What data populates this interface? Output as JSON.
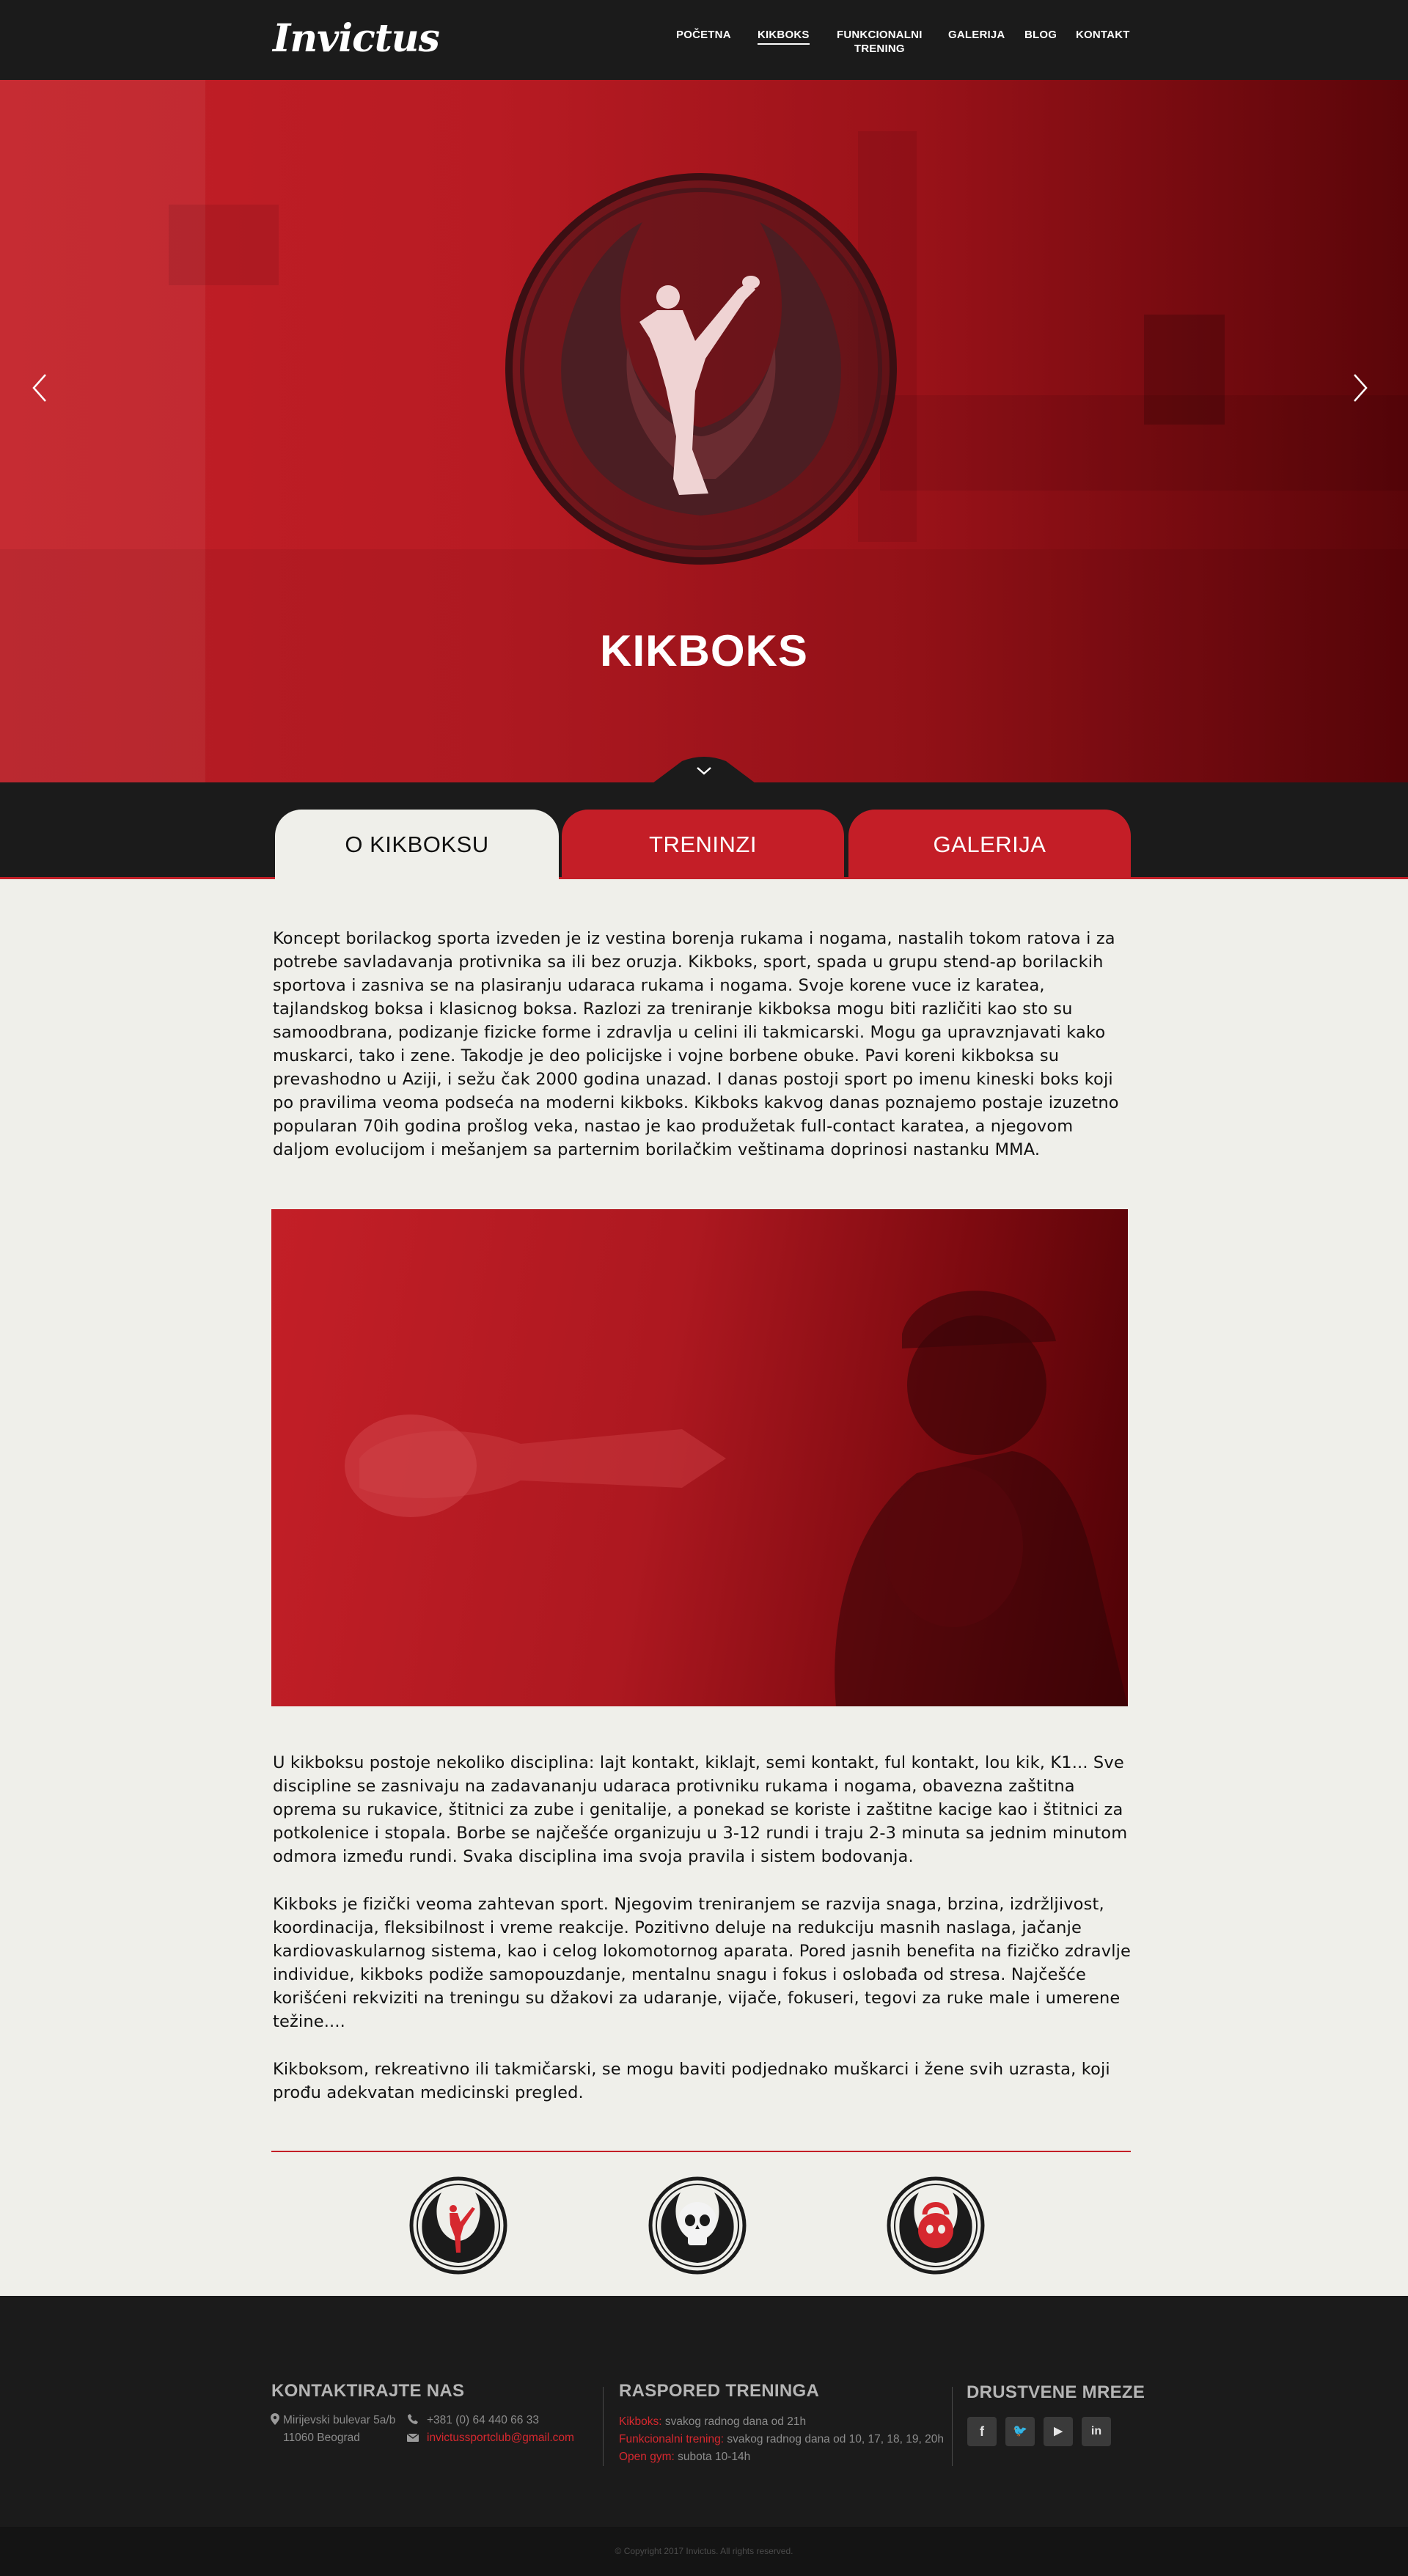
{
  "header": {
    "logo": "Invictus",
    "nav": [
      {
        "label": "POČETNA"
      },
      {
        "label": "KIKBOKS",
        "active": true
      },
      {
        "label": "FUNKCIONALNI\nTRENING"
      },
      {
        "label": "GALERIJA"
      },
      {
        "label": "BLOG"
      },
      {
        "label": "KONTAKT"
      }
    ]
  },
  "hero": {
    "title": "KIKBOKS",
    "prev_icon": "chevron-left-icon",
    "next_icon": "chevron-right-icon",
    "scroll_icon": "chevron-down-icon"
  },
  "tabs": [
    {
      "label": "O KIKBOKSU",
      "active": true
    },
    {
      "label": "TRENINZI",
      "active": false
    },
    {
      "label": "GALERIJA",
      "active": false
    }
  ],
  "content": {
    "intro": "Koncept borilackog sporta izveden je iz vestina borenja rukama i nogama, nastalih tokom ratova i za potrebe savladavanja protivnika sa ili bez oruzja. Kikboks, sport, spada u grupu stend-ap borilackih sportova i zasniva se na plasiranju udaraca rukama i nogama. Svoje korene vuce iz karatea, tajlandskog boksa i klasicnog boksa. Razlozi za treniranje kikboksa mogu biti različiti kao sto su samoodbrana, podizanje fizicke forme i zdravlja u celini ili takmicarski. Mogu ga upravznjavati kako muskarci, tako i zene. Takodje je deo policijske i vojne borbene obuke. Pavi koreni kikboksa su prevashodno u Aziji, i sežu čak 2000 godina unazad. I danas postoji sport po imenu kineski boks koji po pravilima veoma podseća na moderni kikboks. Kikboks kakvog danas poznajemo postaje izuzetno popularan 70ih godina prošlog veka, nastao je kao produžetak full-contact karatea, a njegovom daljom evolucijom i mešanjem sa parternim borilačkim veštinama doprinosi nastanku MMA.",
    "p2": "U kikboksu postoje nekoliko disciplina: lajt kontakt, kiklajt, semi kontakt, ful kontakt, lou kik, K1... Sve discipline se zasnivaju na zadavananju udaraca protivniku rukama i nogama, obavezna zaštitna oprema su rukavice, štitnici za zube i genitalije, a ponekad se koriste i zaštitne kacige kao i štitnici za potkolenice i stopala. Borbe se najčešće organizuju u 3-12 rundi i traju 2-3 minuta sa jednim minutom odmora između rundi. Svaka disciplina ima svoja pravila i sistem bodovanja.",
    "p3": "Kikboks je fizički veoma zahtevan sport. Njegovim treniranjem se razvija snaga, brzina, izdržljivost, koordinacija, fleksibilnost i vreme reakcije. Pozitivno deluje na redukciju masnih naslaga, jačanje kardiovaskularnog sistema, kao i celog lokomotornog aparata. Pored jasnih benefita na fizičko zdravlje individue, kikboks podiže samopouzdanje, mentalnu snagu i fokus i oslobađa od stresa. Najčešće korišćeni rekviziti na treningu su džakovi za udaranje, vijače, fokuseri, tegovi za ruke male i umerene težine....",
    "p4": "Kikboksom, rekreativno ili takmičarski, se mogu baviti podjednako muškarci i žene svih uzrasta, koji prođu adekvatan medicinski pregled."
  },
  "badges": [
    "kickboxer-emblem-icon",
    "skull-emblem-icon",
    "kettlebell-emblem-icon"
  ],
  "footer": {
    "contact": {
      "title": "KONTAKTIRAJTE NAS",
      "address_line1": "Mirijevski bulevar 5a/b",
      "address_line2": "11060 Beograd",
      "phone": "+381 (0) 64 440 66 33",
      "email": "invictussportclub@gmail.com"
    },
    "schedule": {
      "title": "RASPORED TRENINGA",
      "rows": [
        {
          "name": "Kikboks:",
          "time": " svakog radnog dana od 21h"
        },
        {
          "name": "Funkcionalni trening:",
          "time": " svakog radnog dana od 10, 17, 18, 19, 20h"
        },
        {
          "name": "Open gym:",
          "time": " subota 10-14h"
        }
      ]
    },
    "social": {
      "title": "DRUSTVENE MREZE",
      "icons": [
        {
          "name": "facebook-icon",
          "glyph": "f"
        },
        {
          "name": "twitter-icon",
          "glyph": "🐦"
        },
        {
          "name": "youtube-icon",
          "glyph": "▶"
        },
        {
          "name": "linkedin-icon",
          "glyph": "in"
        }
      ]
    },
    "copyright": "© Copyright 2017 Invictus. All rights reserved."
  },
  "colors": {
    "brand_red": "#c31f27",
    "dark": "#1b1b1b",
    "content_bg": "#efefea"
  }
}
